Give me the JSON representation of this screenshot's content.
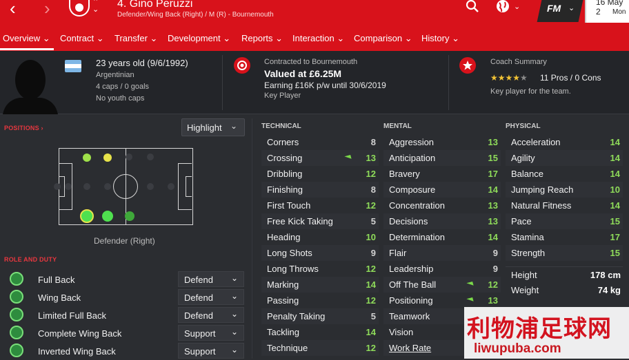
{
  "header": {
    "player_title": "4. Gino Peruzzi",
    "player_subtitle": "Defender/Wing Back (Right) / M (R) - Bournemouth",
    "game_logo": "FM",
    "date_line1": "16 May 2",
    "date_line2": "Mon"
  },
  "tabs": [
    "Overview",
    "Contract",
    "Transfer",
    "Development",
    "Reports",
    "Interaction",
    "Comparison",
    "History"
  ],
  "profile": {
    "age": "23 years old (9/6/1992)",
    "nationality": "Argentinian",
    "caps": "4 caps / 0 goals",
    "youth": "No youth caps"
  },
  "contract": {
    "label": "Contracted to Bournemouth",
    "value": "Valued at £6.25M",
    "wage": "Earning £16K p/w until 30/6/2019",
    "status": "Key Player"
  },
  "coach": {
    "label": "Coach Summary",
    "stars": 4,
    "max_stars": 5,
    "pros": "11 Pros / 0 Cons",
    "summary": "Key player for the team."
  },
  "positions": {
    "heading": "POSITIONS",
    "highlight_label": "Highlight",
    "caption": "Defender (Right)"
  },
  "roles": {
    "heading": "ROLE AND DUTY",
    "items": [
      {
        "name": "Full Back",
        "duty": "Defend"
      },
      {
        "name": "Wing Back",
        "duty": "Defend"
      },
      {
        "name": "Limited Full Back",
        "duty": "Defend"
      },
      {
        "name": "Complete Wing Back",
        "duty": "Support"
      },
      {
        "name": "Inverted Wing Back",
        "duty": "Support"
      }
    ]
  },
  "technical": {
    "heading": "TECHNICAL",
    "attrs": [
      {
        "name": "Corners",
        "value": "8",
        "arrow": false
      },
      {
        "name": "Crossing",
        "value": "13",
        "arrow": true
      },
      {
        "name": "Dribbling",
        "value": "12",
        "arrow": false
      },
      {
        "name": "Finishing",
        "value": "8",
        "arrow": false
      },
      {
        "name": "First Touch",
        "value": "12",
        "arrow": false
      },
      {
        "name": "Free Kick Taking",
        "value": "5",
        "arrow": false
      },
      {
        "name": "Heading",
        "value": "10",
        "arrow": false
      },
      {
        "name": "Long Shots",
        "value": "9",
        "arrow": false
      },
      {
        "name": "Long Throws",
        "value": "12",
        "arrow": false
      },
      {
        "name": "Marking",
        "value": "14",
        "arrow": false
      },
      {
        "name": "Passing",
        "value": "12",
        "arrow": false
      },
      {
        "name": "Penalty Taking",
        "value": "5",
        "arrow": false
      },
      {
        "name": "Tackling",
        "value": "14",
        "arrow": false
      },
      {
        "name": "Technique",
        "value": "12",
        "arrow": false
      }
    ]
  },
  "mental": {
    "heading": "MENTAL",
    "attrs": [
      {
        "name": "Aggression",
        "value": "13",
        "arrow": false
      },
      {
        "name": "Anticipation",
        "value": "15",
        "arrow": false
      },
      {
        "name": "Bravery",
        "value": "17",
        "arrow": false
      },
      {
        "name": "Composure",
        "value": "14",
        "arrow": false
      },
      {
        "name": "Concentration",
        "value": "13",
        "arrow": false
      },
      {
        "name": "Decisions",
        "value": "13",
        "arrow": false
      },
      {
        "name": "Determination",
        "value": "14",
        "arrow": false
      },
      {
        "name": "Flair",
        "value": "9",
        "arrow": false
      },
      {
        "name": "Leadership",
        "value": "9",
        "arrow": false
      },
      {
        "name": "Off The Ball",
        "value": "12",
        "arrow": true
      },
      {
        "name": "Positioning",
        "value": "13",
        "arrow": true
      },
      {
        "name": "Teamwork",
        "value": "",
        "arrow": false
      },
      {
        "name": "Vision",
        "value": "",
        "arrow": false
      },
      {
        "name": "Work Rate",
        "value": "",
        "arrow": false
      }
    ]
  },
  "physical": {
    "heading": "PHYSICAL",
    "attrs": [
      {
        "name": "Acceleration",
        "value": "14"
      },
      {
        "name": "Agility",
        "value": "14"
      },
      {
        "name": "Balance",
        "value": "14"
      },
      {
        "name": "Jumping Reach",
        "value": "10"
      },
      {
        "name": "Natural Fitness",
        "value": "14"
      },
      {
        "name": "Pace",
        "value": "15"
      },
      {
        "name": "Stamina",
        "value": "17"
      },
      {
        "name": "Strength",
        "value": "15"
      }
    ]
  },
  "body": {
    "height_label": "Height",
    "height": "178 cm",
    "weight_label": "Weight",
    "weight": "74 kg"
  },
  "watermark": {
    "text": "利物浦足球网",
    "url": "liwupuba.com"
  },
  "colors": {
    "header_red": "#d8121b",
    "green_attr": "#8fdc5a",
    "natural_pos": "#4fe04f",
    "secondary_pos": "#e6e24a"
  }
}
